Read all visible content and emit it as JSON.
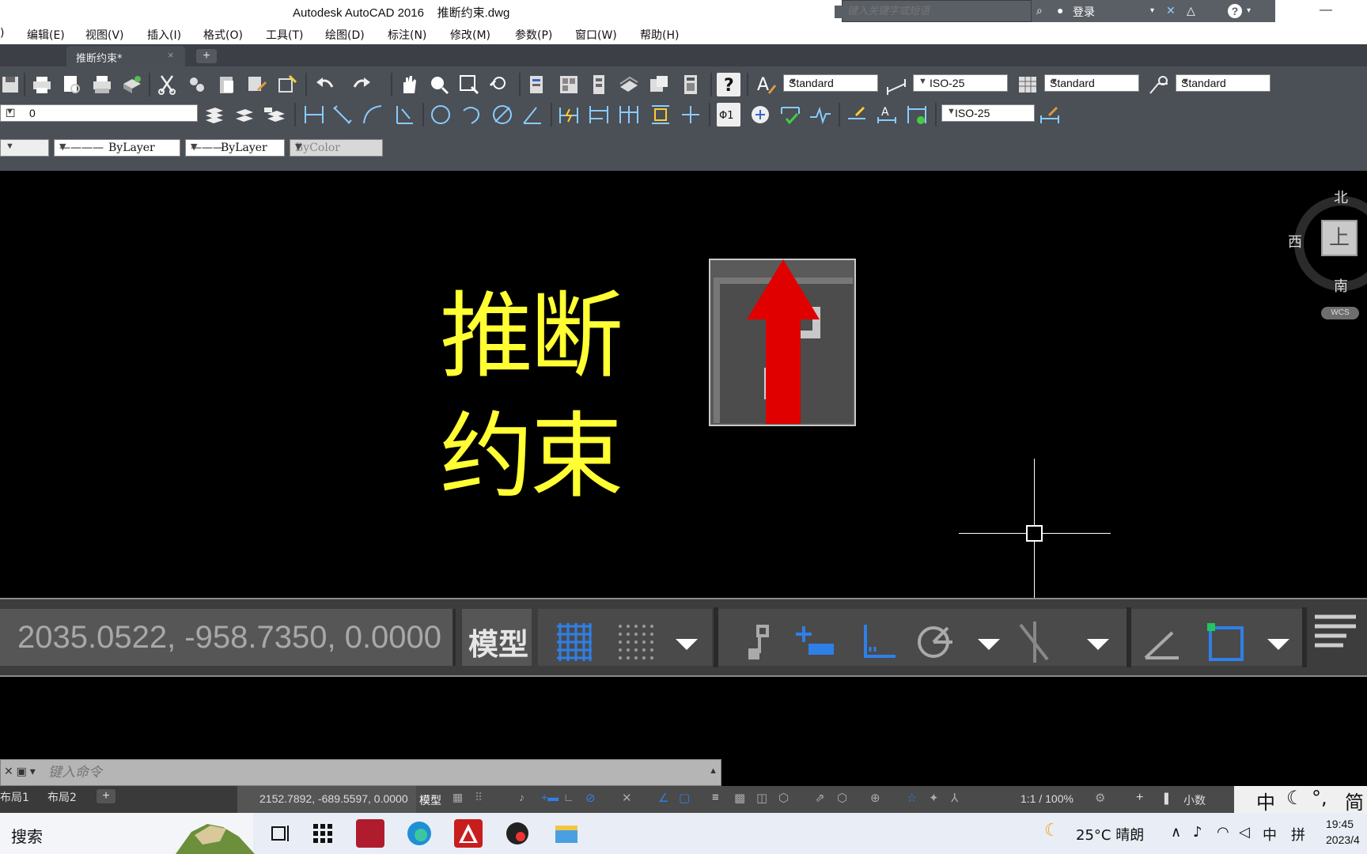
{
  "window": {
    "title": "Autodesk AutoCAD 2016    推断约束.dwg",
    "search_placeholder": "键入关键字或短语",
    "login_label": "登录"
  },
  "menu": [
    "编辑(E)",
    "视图(V)",
    "插入(I)",
    "格式(O)",
    "工具(T)",
    "绘图(D)",
    "标注(N)",
    "修改(M)",
    "参数(P)",
    "窗口(W)",
    "帮助(H)"
  ],
  "menu_partial_first": ")",
  "tabs": {
    "active": "推断约束*",
    "close": "×",
    "add": "+"
  },
  "toolbar": {
    "text_style": "Standard",
    "dim_style": "ISO-25",
    "table_style": "Standard",
    "mleader_style": "Standard",
    "layer": "0",
    "dim_style_2": "ISO-25",
    "linetype": "ByLayer",
    "lineweight": "ByLayer",
    "plotstyle": "ByColor"
  },
  "drawing": {
    "text_line1": "推断",
    "text_line2": "约束"
  },
  "viewcube": {
    "north": "北",
    "south": "南",
    "west": "西",
    "face": "上",
    "wcs": "WCS"
  },
  "big_status": {
    "coordinates": "2035.0522, -958.7350, 0.0000",
    "space": "模型"
  },
  "command_line": {
    "placeholder": "键入命令"
  },
  "layout_tabs": [
    "布局1",
    "布局2"
  ],
  "layout_add": "+",
  "status": {
    "coordinates": "2152.7892, -689.5597, 0.0000",
    "space": "模型",
    "scale": "1:1 / 100%",
    "units": "小数"
  },
  "ime": {
    "lang": "中",
    "punct": "°,",
    "mode": "简"
  },
  "taskbar": {
    "search_label": "搜索",
    "weather": "25°C 晴朗",
    "input_lang": "中",
    "input_mode": "拼",
    "time": "19:45",
    "date": "2023/4"
  },
  "colors": {
    "drawing_text": "#ffff33",
    "arrow": "#e00000",
    "active_toggle": "#2f7fe8",
    "background": "#000000"
  }
}
